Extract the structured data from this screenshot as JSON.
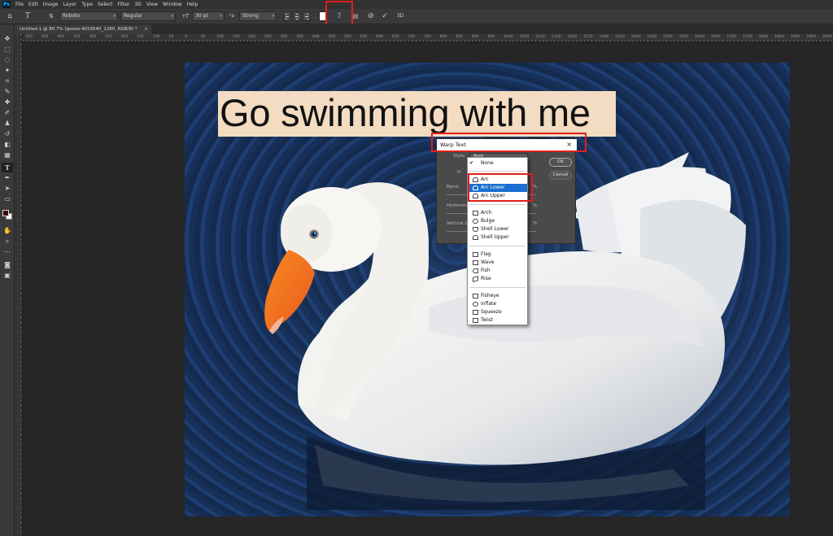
{
  "app": {
    "logo": "Ps",
    "menu": [
      "File",
      "Edit",
      "Image",
      "Layer",
      "Type",
      "Select",
      "Filter",
      "3D",
      "View",
      "Window",
      "Help"
    ]
  },
  "options_bar": {
    "font_family": "Roboto",
    "font_style": "Regular",
    "font_size": "30 pt",
    "anti_alias": "Strong",
    "text_color": "#ffffff",
    "icons": [
      "home-icon",
      "type-tool-icon",
      "orientation-icon",
      "font-size-icon",
      "aa-icon",
      "align-left-icon",
      "align-center-icon",
      "align-right-icon",
      "warp-text-icon",
      "character-panel-icon",
      "cancel-icon",
      "commit-icon",
      "3d-icon"
    ]
  },
  "document_tab": {
    "title": "Untitled-1 @ 80.7% (goose-4019540_1280, RGB/8) *",
    "close": "×"
  },
  "ruler": {
    "ticks": [
      "500",
      "450",
      "400",
      "350",
      "300",
      "250",
      "200",
      "150",
      "100",
      "50",
      "0",
      "50",
      "100",
      "150",
      "200",
      "250",
      "300",
      "350",
      "400",
      "450",
      "500",
      "550",
      "600",
      "650",
      "700",
      "750",
      "800",
      "850",
      "900",
      "950",
      "1000",
      "1050",
      "1100",
      "1150",
      "1200",
      "1250",
      "1300",
      "1350",
      "1400",
      "1450",
      "1500",
      "1550",
      "1600",
      "1650",
      "1700",
      "1750",
      "1800",
      "1850",
      "1900",
      "1950",
      "2000"
    ]
  },
  "canvas": {
    "text": "Go swimming with me"
  },
  "warp_dialog": {
    "title": "Warp Text",
    "close": "×",
    "style_label": "Style:",
    "style_value": "Arch",
    "h_label": "H",
    "bend_label": "Bend:",
    "horizontal_label": "Horizontal",
    "vertical_label": "Vertical D",
    "percent": "%",
    "ok_label": "OK",
    "cancel_label": "Cancel"
  },
  "style_dropdown": {
    "selected": "Arc Lower",
    "items": [
      {
        "label": "None",
        "check": "✔"
      },
      {
        "label": "Arc"
      },
      {
        "label": "Arc Lower"
      },
      {
        "label": "Arc Upper"
      },
      {
        "label": "Arch"
      },
      {
        "label": "Bulge"
      },
      {
        "label": "Shell Lower"
      },
      {
        "label": "Shell Upper"
      },
      {
        "label": "Flag"
      },
      {
        "label": "Wave"
      },
      {
        "label": "Fish"
      },
      {
        "label": "Rise"
      },
      {
        "label": "Fisheye"
      },
      {
        "label": "Inflate"
      },
      {
        "label": "Squeeze"
      },
      {
        "label": "Twist"
      }
    ]
  },
  "colors": {
    "highlight": "#e0201a",
    "selection": "#1a6fd0",
    "text_background": "#f3dcc1"
  }
}
